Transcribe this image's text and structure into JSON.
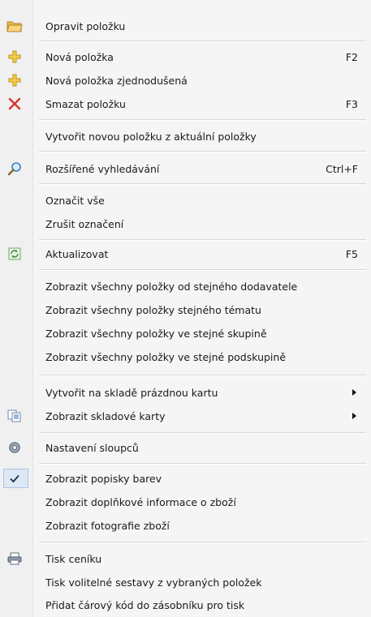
{
  "menu": {
    "items": [
      {
        "label": "Opravit položku",
        "shortcut": "",
        "icon": "folder-open-icon"
      },
      {
        "label": "Nová položka",
        "shortcut": "F2",
        "icon": "add-plus-icon"
      },
      {
        "label": "Nová položka zjednodušená",
        "shortcut": "",
        "icon": "add-plus-icon"
      },
      {
        "label": "Smazat položku",
        "shortcut": "F3",
        "icon": "delete-x-icon"
      },
      {
        "label": "Vytvořit novou položku z aktuální položky",
        "shortcut": "",
        "icon": ""
      },
      {
        "label": "Rozšířené vyhledávání",
        "shortcut": "Ctrl+F",
        "icon": "search-magnifier-icon"
      },
      {
        "label": "Označit vše",
        "shortcut": "",
        "icon": ""
      },
      {
        "label": "Zrušit označení",
        "shortcut": "",
        "icon": ""
      },
      {
        "label": "Aktualizovat",
        "shortcut": "F5",
        "icon": "refresh-icon"
      },
      {
        "label": "Zobrazit všechny položky od stejného dodavatele",
        "shortcut": "",
        "icon": ""
      },
      {
        "label": "Zobrazit všechny položky  stejného tématu",
        "shortcut": "",
        "icon": ""
      },
      {
        "label": "Zobrazit všechny položky ve stejné skupině",
        "shortcut": "",
        "icon": ""
      },
      {
        "label": "Zobrazit všechny položky ve stejné podskupině",
        "shortcut": "",
        "icon": ""
      },
      {
        "label": "Vytvořit na skladě prázdnou kartu",
        "shortcut": "",
        "icon": "",
        "submenu": true
      },
      {
        "label": "Zobrazit skladové karty",
        "shortcut": "",
        "icon": "copy-cards-icon",
        "submenu": true
      },
      {
        "label": "Nastavení sloupců",
        "shortcut": "",
        "icon": "gear-icon"
      },
      {
        "label": "Zobrazit popisky barev",
        "shortcut": "",
        "icon": "checkmark-icon",
        "checked": true
      },
      {
        "label": "Zobrazit doplňkové informace o zboží",
        "shortcut": "",
        "icon": ""
      },
      {
        "label": "Zobrazit fotografie zboží",
        "shortcut": "",
        "icon": ""
      },
      {
        "label": "Tisk ceníku",
        "shortcut": "",
        "icon": "printer-icon"
      },
      {
        "label": "Tisk volitelné sestavy z vybraných položek",
        "shortcut": "",
        "icon": ""
      },
      {
        "label": "Přidat čárový kód do zásobníku pro tisk",
        "shortcut": "",
        "icon": ""
      }
    ]
  },
  "colors": {
    "menu_background": "#f5f5f5",
    "gutter_background": "#f0f0f0",
    "separator": "#d6d6d6",
    "check_highlight": "#dde8f5",
    "delete_red": "#d9342b",
    "plus_gold": "#e8b21c"
  }
}
